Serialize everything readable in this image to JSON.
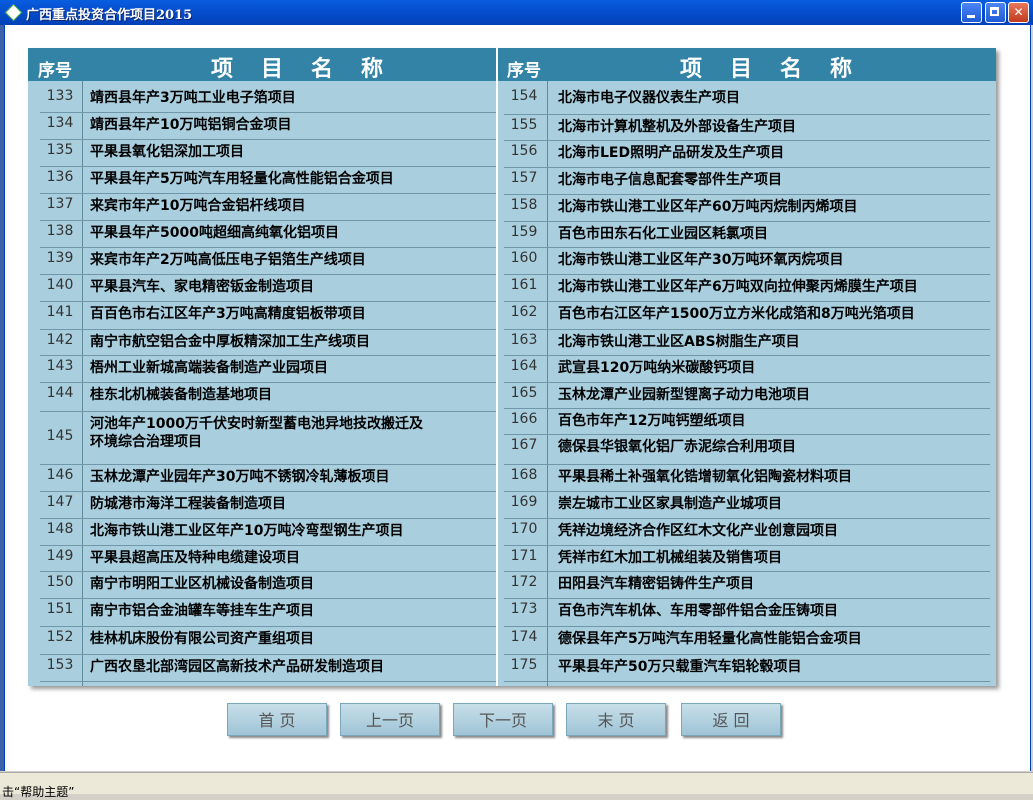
{
  "window": {
    "title": "广西重点投资合作项目2015"
  },
  "header": {
    "seq_label": "序号",
    "name_label": "项目名称"
  },
  "left_rows": [
    {
      "num": "133",
      "text": "靖西县年产3万吨工业电子箔项目"
    },
    {
      "num": "134",
      "text": "靖西县年产10万吨铝铜合金项目"
    },
    {
      "num": "135",
      "text": "平果县氧化铝深加工项目"
    },
    {
      "num": "136",
      "text": "平果县年产5万吨汽车用轻量化高性能铝合金项目"
    },
    {
      "num": "137",
      "text": "来宾市年产10万吨合金铝杆线项目"
    },
    {
      "num": "138",
      "text": "平果县年产5000吨超细高纯氧化铝项目"
    },
    {
      "num": "139",
      "text": "来宾市年产2万吨高低压电子铝箔生产线项目"
    },
    {
      "num": "140",
      "text": "平果县汽车、家电精密钣金制造项目"
    },
    {
      "num": "141",
      "text": "百百色市右江区年产3万吨高精度铝板带项目"
    },
    {
      "num": "142",
      "text": "南宁市航空铝合金中厚板精深加工生产线项目"
    },
    {
      "num": "143",
      "text": "梧州工业新城高端装备制造产业园项目"
    },
    {
      "num": "144",
      "text": "桂东北机械装备制造基地项目"
    },
    {
      "num": "145",
      "text": "河池年产1000万千伏安时新型蓄电池异地技改搬迁及",
      "text2": "环境综合治理项目"
    },
    {
      "num": "146",
      "text": "玉林龙潭产业园年产30万吨不锈钢冷轧薄板项目"
    },
    {
      "num": "147",
      "text": "防城港市海洋工程装备制造项目"
    },
    {
      "num": "148",
      "text": "北海市铁山港工业区年产10万吨冷弯型钢生产项目"
    },
    {
      "num": "149",
      "text": "平果县超高压及特种电缆建设项目"
    },
    {
      "num": "150",
      "text": "南宁市明阳工业区机械设备制造项目"
    },
    {
      "num": "151",
      "text": "南宁市铝合金油罐车等挂车生产项目"
    },
    {
      "num": "152",
      "text": "桂林机床股份有限公司资产重组项目"
    },
    {
      "num": "153",
      "text": "广西农垦北部湾园区高新技术产品研发制造项目"
    }
  ],
  "right_rows": [
    {
      "num": "154",
      "text": "北海市电子仪器仪表生产项目"
    },
    {
      "num": "155",
      "text": "北海市计算机整机及外部设备生产项目"
    },
    {
      "num": "156",
      "text": "北海市LED照明产品研发及生产项目"
    },
    {
      "num": "157",
      "text": "北海市电子信息配套零部件生产项目"
    },
    {
      "num": "158",
      "text": "北海市铁山港工业区年产60万吨丙烷制丙烯项目"
    },
    {
      "num": "159",
      "text": "百色市田东石化工业园区耗氯项目"
    },
    {
      "num": "160",
      "text": "北海市铁山港工业区年产30万吨环氧丙烷项目"
    },
    {
      "num": "161",
      "text": "北海市铁山港工业区年产6万吨双向拉伸聚丙烯膜生产项目"
    },
    {
      "num": "162",
      "text": "百色市右江区年产1500万立方米化成箔和8万吨光箔项目"
    },
    {
      "num": "163",
      "text": "北海市铁山港工业区ABS树脂生产项目"
    },
    {
      "num": "164",
      "text": "武宣县120万吨纳米碳酸钙项目"
    },
    {
      "num": "165",
      "text": "玉林龙潭产业园新型锂离子动力电池项目"
    },
    {
      "num": "166",
      "text": "百色市年产12万吨钙塑纸项目"
    },
    {
      "num": "167",
      "text": "德保县华银氧化铝厂赤泥综合利用项目"
    },
    {
      "num": "168",
      "text": "平果县稀土补强氧化锆增韧氧化铝陶瓷材料项目"
    },
    {
      "num": "169",
      "text": "崇左城市工业区家具制造产业城项目"
    },
    {
      "num": "170",
      "text": "凭祥边境经济合作区红木文化产业创意园项目"
    },
    {
      "num": "171",
      "text": "凭祥市红木加工机械组装及销售项目"
    },
    {
      "num": "172",
      "text": "田阳县汽车精密铝铸件生产项目"
    },
    {
      "num": "173",
      "text": "百色市汽车机体、车用零部件铝合金压铸项目"
    },
    {
      "num": "174",
      "text": "德保县年产5万吨汽车用轻量化高性能铝合金项目"
    },
    {
      "num": "175",
      "text": "平果县年产50万只载重汽车铝轮毂项目"
    }
  ],
  "buttons": {
    "first": "首 页",
    "prev": "上一页",
    "next": "下一页",
    "last": "末 页",
    "back": "返 回"
  },
  "status": {
    "text": "击“帮助主题”"
  }
}
